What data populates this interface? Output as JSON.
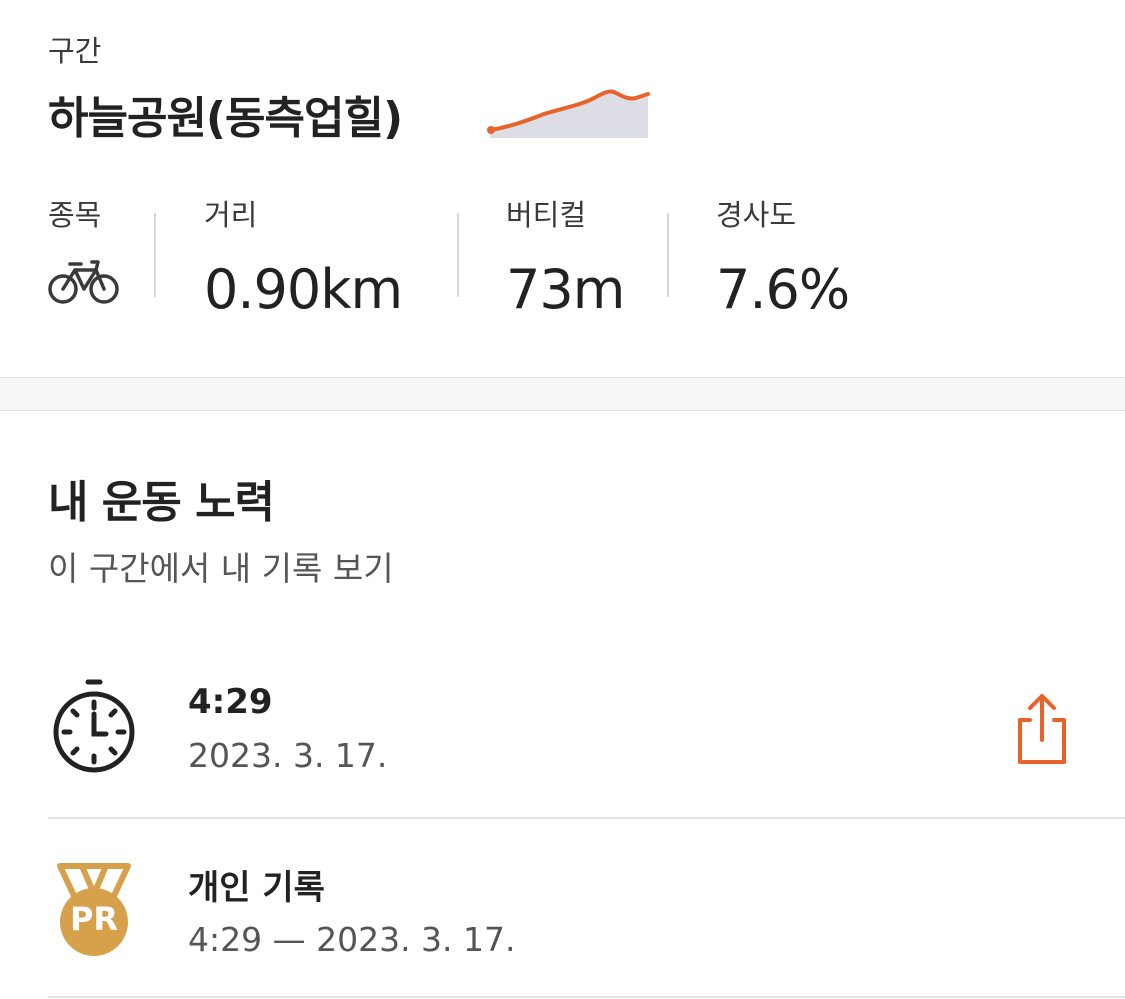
{
  "segment": {
    "kicker": "구간",
    "name": "하늘공원(동측업힐)",
    "accent_color": "#E8622A"
  },
  "stats": {
    "sport": {
      "label": "종목",
      "icon": "bike-icon"
    },
    "distance": {
      "label": "거리",
      "value": "0.90km"
    },
    "vertical": {
      "label": "버티컬",
      "value": "73m"
    },
    "grade": {
      "label": "경사도",
      "value": "7.6%"
    }
  },
  "effort": {
    "title": "내 운동 노력",
    "subtitle": "이 구간에서 내 기록 보기",
    "best": {
      "icon": "stopwatch-icon",
      "time": "4:29",
      "date": "2023. 3. 17.",
      "share_icon": "share-icon"
    },
    "pr": {
      "icon": "pr-medal-icon",
      "badge": "PR",
      "title": "개인 기록",
      "detail": "4:29 — 2023. 3. 17.",
      "medal_color": "#D7A04A"
    }
  }
}
